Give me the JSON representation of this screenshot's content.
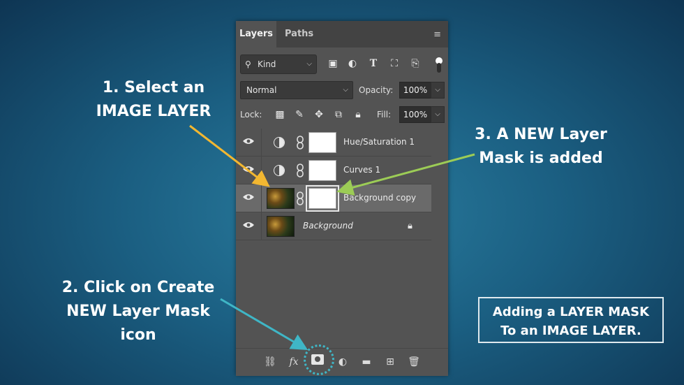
{
  "panel": {
    "tabs": [
      {
        "label": "Layers",
        "active": true
      },
      {
        "label": "Paths",
        "active": false
      }
    ],
    "filter": {
      "kind_label": "Kind"
    },
    "blend": {
      "mode": "Normal",
      "opacity_label": "Opacity:",
      "opacity": "100%"
    },
    "lock": {
      "label": "Lock:",
      "fill_label": "Fill:",
      "fill": "100%"
    },
    "layers": [
      {
        "name": "Hue/Saturation 1",
        "type": "adjustment",
        "selected": false
      },
      {
        "name": "Curves 1",
        "type": "adjustment",
        "selected": false
      },
      {
        "name": "Background copy",
        "type": "image-with-mask",
        "selected": true
      },
      {
        "name": "Background",
        "type": "image",
        "locked": true,
        "selected": false
      }
    ],
    "bottom_icons": [
      "link-icon",
      "fx-icon",
      "layer-mask-icon",
      "adjustment-icon",
      "folder-icon",
      "new-layer-icon",
      "trash-icon"
    ],
    "fx_label": "fx"
  },
  "annotations": {
    "step1": [
      "1. Select an",
      "IMAGE LAYER"
    ],
    "step2": [
      "2. Click on Create",
      "NEW Layer Mask",
      "icon"
    ],
    "step3": [
      "3. A NEW Layer",
      "Mask is added"
    ]
  },
  "info_box": [
    "Adding a LAYER MASK",
    "To an IMAGE LAYER."
  ],
  "colors": {
    "arrow_step1": "#f2b731",
    "arrow_step2": "#3fb6c6",
    "arrow_step3": "#9ccc56",
    "panel_bg": "#535353"
  }
}
